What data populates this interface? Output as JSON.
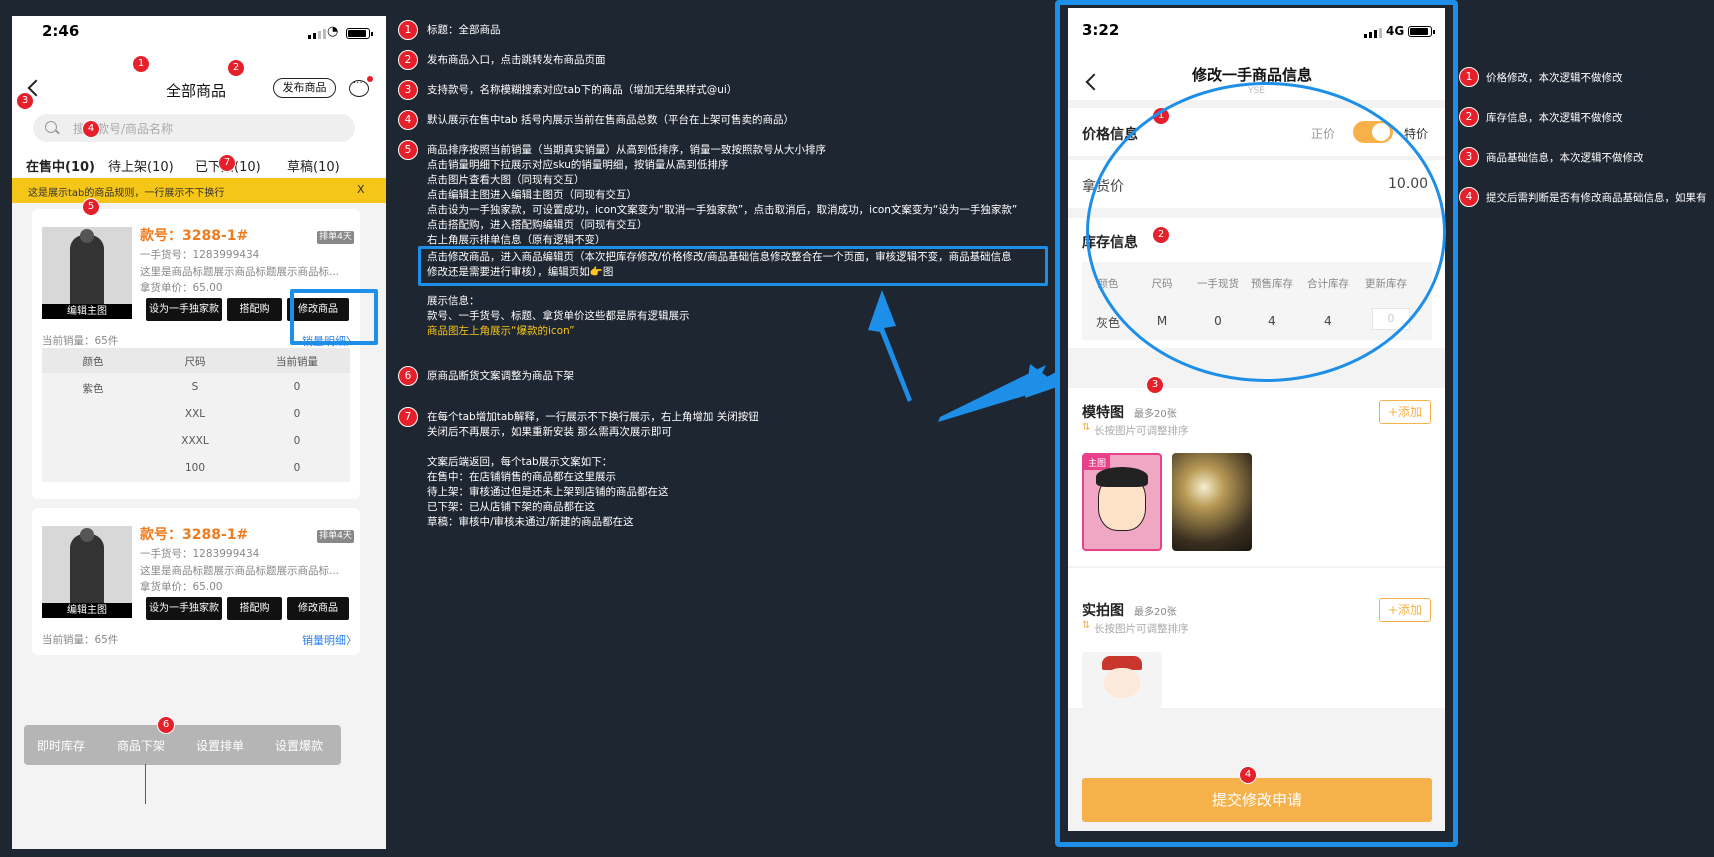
{
  "phone1": {
    "status_time": "2:46",
    "title": "全部商品",
    "publish_button": "发布商品",
    "search_placeholder": "搜索款号/商品名称",
    "tabs": [
      "在售中(10)",
      "待上架(10)",
      "已下架(10)",
      "草稿(10)"
    ],
    "tip": "这是展示tab的商品规则，一行展示不下换行",
    "tip_close": "X",
    "cards": [
      {
        "style_no": "款号：3288-1#",
        "tag": "排单4天",
        "sku_no": "一手货号：1283999434",
        "desc": "这里是商品标题展示商品标题展示商品标...",
        "price": "拿货单价：65.00",
        "thumb_label": "编辑主图",
        "btn_exclusive": "设为一手独家款",
        "btn_match": "搭配购",
        "btn_edit": "修改商品",
        "sales": "当前销量：65件",
        "sales_link": "销量明细〉",
        "table_headers": [
          "颜色",
          "尺码",
          "当前销量"
        ],
        "table_rows": [
          [
            "紫色",
            "S",
            "0"
          ],
          [
            "",
            "XXL",
            "0"
          ],
          [
            "",
            "XXXL",
            "0"
          ],
          [
            "",
            "100",
            "0"
          ]
        ]
      },
      {
        "style_no": "款号：3288-1#",
        "tag": "排单4天",
        "sku_no": "一手货号：1283999434",
        "desc": "这里是商品标题展示商品标题展示商品标...",
        "price": "拿货单价：65.00",
        "thumb_label": "编辑主图",
        "btn_exclusive": "设为一手独家款",
        "btn_match": "搭配购",
        "btn_edit": "修改商品",
        "sales": "当前销量：65件",
        "sales_link": "销量明细〉"
      }
    ],
    "bottom_actions": [
      "即时库存",
      "商品下架",
      "设置排单",
      "设置爆款"
    ],
    "badges": [
      "1",
      "2",
      "3",
      "4",
      "5",
      "6",
      "7"
    ]
  },
  "notes": {
    "n1": "标题：全部商品",
    "n2": "发布商品入口，点击跳转发布商品页面",
    "n3": "支持款号，名称模糊搜索对应tab下的商品（增加无结果样式@ui）",
    "n4": "默认展示在售中tab 括号内展示当前在售商品总数（平台在上架可售卖的商品）",
    "n5_lines": [
      "商品排序按照当前销量（当期真实销量）从高到低排序，销量一致按照款号从大小排序",
      "点击销量明细下拉展示对应sku的销量明细，按销量从高到低排序",
      "点击图片查看大图（同现有交互）",
      "点击编辑主图进入编辑主图页（同现有交互）",
      "点击设为一手独家款，可设置成功，icon文案变为“取消一手独家款”，点击取消后，取消成功，icon文案变为“设为一手独家款”",
      "点击搭配购，进入搭配购编辑页（同现有交互）",
      "右上角展示排单信息（原有逻辑不变）"
    ],
    "n5_hl_lines": [
      "点击修改商品，进入商品编辑页（本次把库存修改/价格修改/商品基础信息修改整合在一个页面，审核逻辑不变，商品基础信息",
      "修改还是需要进行审核），编辑页如👉图"
    ],
    "n5_show": [
      "展示信息：",
      "款号、一手货号、标题、拿货单价这些都是原有逻辑展示"
    ],
    "n5_yellow": "商品图左上角展示“爆款的icon”",
    "n6": "原商品断货文案调整为商品下架",
    "n7_lines": [
      "在每个tab增加tab解释，一行展示不下换行展示，右上角增加 关闭按钮",
      "关闭后不再展示，如果重新安装 那么需再次展示即可",
      "",
      "文案后端返回，每个tab展示文案如下：",
      "在售中：在店铺销售的商品都在这里展示",
      "待上架：审核通过但是还未上架到店铺的商品都在这",
      "已下架：已从店铺下架的商品都在这",
      "草稿：审核中/审核未通过/新建的商品都在这"
    ],
    "nums": [
      "1",
      "2",
      "3",
      "4",
      "5",
      "6",
      "7"
    ]
  },
  "phone2": {
    "status_time": "3:22",
    "network": "4G",
    "title": "修改一手商品信息",
    "title_sub": "YSE",
    "price_section": "价格信息",
    "price_normal": "正价",
    "price_special": "特价",
    "cost_label": "拿货价",
    "cost_value": "10.00",
    "stock_section": "库存信息",
    "stock_headers": [
      "颜色",
      "尺码",
      "一手现货",
      "预售库存",
      "合计库存",
      "更新库存"
    ],
    "stock_row": [
      "灰色",
      "M",
      "0",
      "4",
      "4",
      "0"
    ],
    "model_title": "模特图",
    "model_limit": "最多20张",
    "model_hint": "长按图片可调整排序",
    "main_tag": "主图",
    "real_title": "实拍图",
    "real_limit": "最多20张",
    "real_hint": "长按图片可调整排序",
    "add_label": "+添加",
    "submit": "提交修改申请",
    "badges": [
      "1",
      "2",
      "3",
      "4"
    ]
  },
  "right_notes": {
    "nums": [
      "1",
      "2",
      "3",
      "4"
    ],
    "n1": "价格修改，本次逻辑不做修改",
    "n2": "库存信息，本次逻辑不做修改",
    "n3": "商品基础信息，本次逻辑不做修改",
    "n4": "提交后需判断是否有修改商品基础信息，如果有"
  },
  "colors": {
    "accent_blue": "#1e8fe8",
    "badge_red": "#e5202b",
    "orange": "#f07b1d",
    "yellow_tip": "#f5c518",
    "submit_orange": "#f7b14a"
  }
}
